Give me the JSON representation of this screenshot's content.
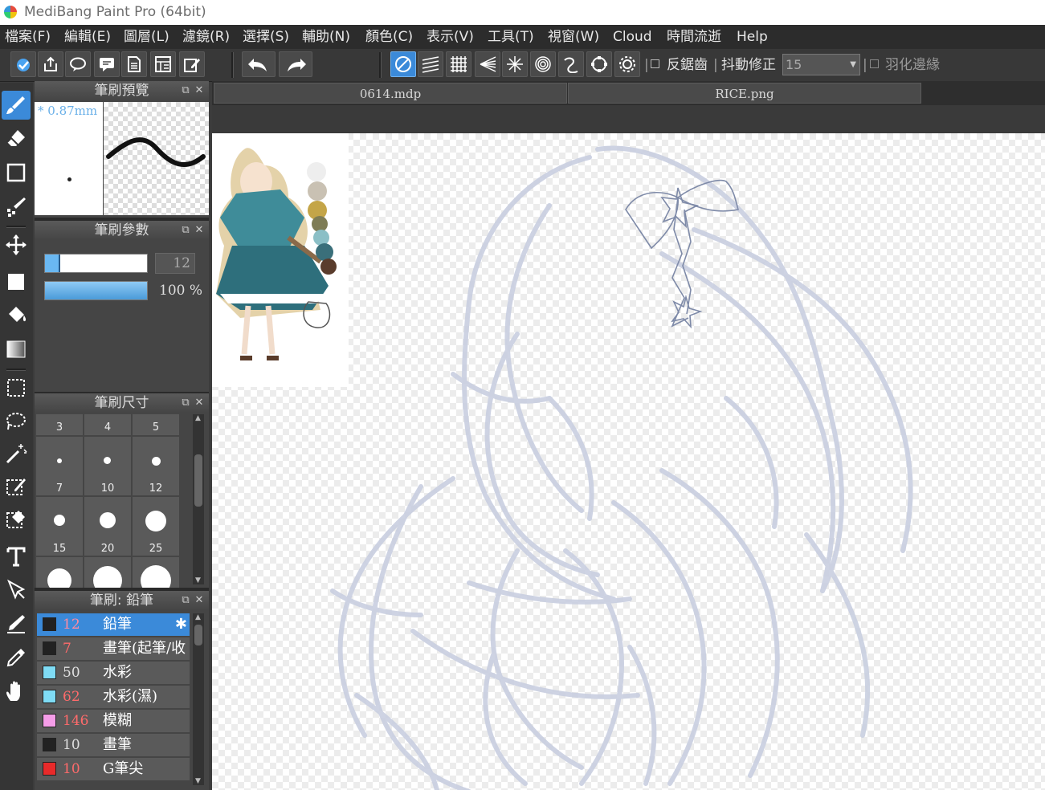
{
  "app": {
    "title": "MediBang Paint Pro (64bit)"
  },
  "menu": [
    "檔案(F)",
    "編輯(E)",
    "圖層(L)",
    "濾鏡(R)",
    "選擇(S)",
    "輔助(N)",
    "顏色(C)",
    "表示(V)",
    "工具(T)",
    "視窗(W)",
    "Cloud",
    "時間流逝",
    "Help"
  ],
  "toolbar": {
    "antialias_label": "反鋸齒",
    "stabilizer_label": "抖動修正",
    "stabilizer_value": "15",
    "feather_label": "羽化邊緣"
  },
  "panels": {
    "brush_preview": {
      "title": "筆刷預覽",
      "size_label": "* 0.87mm"
    },
    "brush_params": {
      "title": "筆刷參數",
      "width_value": "12",
      "opacity_value": "100 %",
      "opacity_fraction": 1.0,
      "width_fraction": 0.13
    },
    "brush_size": {
      "title": "筆刷尺寸",
      "top_labels": [
        "3",
        "4",
        "5"
      ],
      "cells": [
        {
          "label": "7"
        },
        {
          "label": "10"
        },
        {
          "label": "12"
        },
        {
          "label": "15"
        },
        {
          "label": "20"
        },
        {
          "label": "25"
        }
      ]
    },
    "brush_list": {
      "title": "筆刷: 鉛筆",
      "items": [
        {
          "size": "12",
          "name": "鉛筆",
          "color": "#222222",
          "size_color": "#ff8aa0",
          "selected": true
        },
        {
          "size": "7",
          "name": "畫筆(起筆/收",
          "color": "#222222",
          "size_color": "#ff6b6b",
          "selected": false
        },
        {
          "size": "50",
          "name": "水彩",
          "color": "#7fdcf5",
          "size_color": "#e0e0e0",
          "selected": false
        },
        {
          "size": "62",
          "name": "水彩(濕)",
          "color": "#7fdcf5",
          "size_color": "#ff6b6b",
          "selected": false
        },
        {
          "size": "146",
          "name": "模糊",
          "color": "#f59de8",
          "size_color": "#ff6b6b",
          "selected": false
        },
        {
          "size": "10",
          "name": "畫筆",
          "color": "#222222",
          "size_color": "#e0e0e0",
          "selected": false
        },
        {
          "size": "10",
          "name": "G筆尖",
          "color": "#e82a2a",
          "size_color": "#ff6b6b",
          "selected": false
        }
      ]
    }
  },
  "document_tabs": [
    "0614.mdp",
    "RICE.png"
  ],
  "tools": [
    "brush-tool",
    "eraser-tool",
    "shape-tool",
    "fill-brush-tool",
    "move-tool",
    "rectangle-fill-tool",
    "bucket-tool",
    "gradient-tool",
    "select-rect-tool",
    "lasso-tool",
    "magic-wand-tool",
    "select-pen-tool",
    "select-eraser-tool",
    "text-tool",
    "operation-tool",
    "divide-pen-tool",
    "eyedropper-tool",
    "hand-tool"
  ],
  "colors": {
    "accent": "#3b8ad9",
    "sketch": "#c9cfe0",
    "panel": "#454545"
  }
}
